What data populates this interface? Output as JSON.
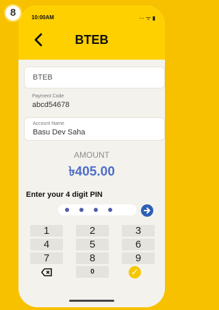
{
  "step": "8",
  "status": {
    "time": "10:00AM",
    "icons": "⋯ ᯤ ▮"
  },
  "header": {
    "title": "BTEB"
  },
  "fields": {
    "biller": "BTEB",
    "payment_code_label": "Payment Code",
    "payment_code": "abcd54678",
    "account_name_label": "Account Name",
    "account_name": "Basu Dev Saha"
  },
  "amount": {
    "label": "AMOUNT",
    "value": "৳405.00"
  },
  "pin": {
    "label": "Enter your 4 digit PIN"
  },
  "keypad": [
    "1",
    "2",
    "3",
    "4",
    "5",
    "6",
    "7",
    "8",
    "9",
    "0"
  ]
}
